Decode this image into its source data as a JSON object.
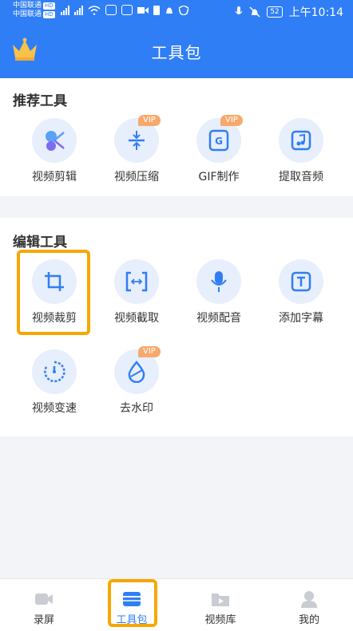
{
  "status_bar": {
    "carrier1": "中国联通",
    "carrier2": "中国联通",
    "hd": "HD",
    "battery": "52",
    "time": "上午10:14"
  },
  "header": {
    "title": "工具包"
  },
  "sections": [
    {
      "title": "推荐工具",
      "tools": [
        {
          "label": "视频剪辑",
          "icon": "scissors-icon",
          "vip": ""
        },
        {
          "label": "视频压缩",
          "icon": "compress-icon",
          "vip": "VIP"
        },
        {
          "label": "GIF制作",
          "icon": "gif-icon",
          "vip": "VIP"
        },
        {
          "label": "提取音频",
          "icon": "music-note-icon",
          "vip": ""
        }
      ]
    },
    {
      "title": "编辑工具",
      "tools": [
        {
          "label": "视频裁剪",
          "icon": "crop-icon",
          "vip": ""
        },
        {
          "label": "视频截取",
          "icon": "trim-icon",
          "vip": ""
        },
        {
          "label": "视频配音",
          "icon": "microphone-icon",
          "vip": ""
        },
        {
          "label": "添加字幕",
          "icon": "text-icon",
          "vip": ""
        },
        {
          "label": "视频变速",
          "icon": "speedometer-icon",
          "vip": ""
        },
        {
          "label": "去水印",
          "icon": "water-drop-icon",
          "vip": "VIP"
        }
      ]
    }
  ],
  "bottom_nav": [
    {
      "label": "录屏",
      "icon": "camera-icon",
      "active": false
    },
    {
      "label": "工具包",
      "icon": "toolbox-icon",
      "active": true
    },
    {
      "label": "视频库",
      "icon": "folder-play-icon",
      "active": false
    },
    {
      "label": "我的",
      "icon": "person-icon",
      "active": false
    }
  ],
  "colors": {
    "primary": "#2f7ef5",
    "highlight": "#f5a800",
    "vip": "#f7a96b"
  }
}
